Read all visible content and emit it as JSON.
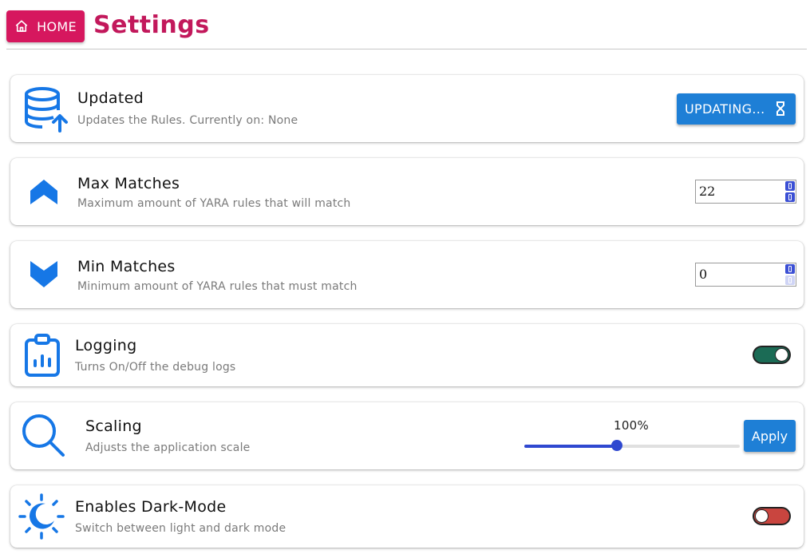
{
  "header": {
    "home_label": "HOME",
    "title": "Settings",
    "accent": "#d6175e"
  },
  "settings": {
    "update": {
      "title": "Updated",
      "desc": "Updates the Rules. Currently on: None",
      "button_label": "UPDATING...",
      "icon": "database-upload-icon"
    },
    "max_matches": {
      "title": "Max Matches",
      "desc": "Maximum amount of YARA rules that will match",
      "value": "22",
      "icon": "chevron-up-icon"
    },
    "min_matches": {
      "title": "Min Matches",
      "desc": "Minimum amount of YARA rules that must match",
      "value": "0",
      "icon": "chevron-down-icon"
    },
    "logging": {
      "title": "Logging",
      "desc": "Turns On/Off the debug logs",
      "enabled": true,
      "icon": "clipboard-chart-icon"
    },
    "scaling": {
      "title": "Scaling",
      "desc": "Adjusts the application scale",
      "value_label": "100%",
      "slider_fraction": 0.43,
      "apply_label": "Apply",
      "icon": "magnifier-icon"
    },
    "dark_mode": {
      "title": "Enables Dark-Mode",
      "desc": "Switch between light and dark mode",
      "enabled": false,
      "icon": "sun-moon-icon"
    }
  },
  "colors": {
    "primary": "#1e7fd6",
    "icon": "#1677e6",
    "toggle_on": "#1b6b55",
    "toggle_off": "#c9453f",
    "slider": "#2f48d0"
  }
}
